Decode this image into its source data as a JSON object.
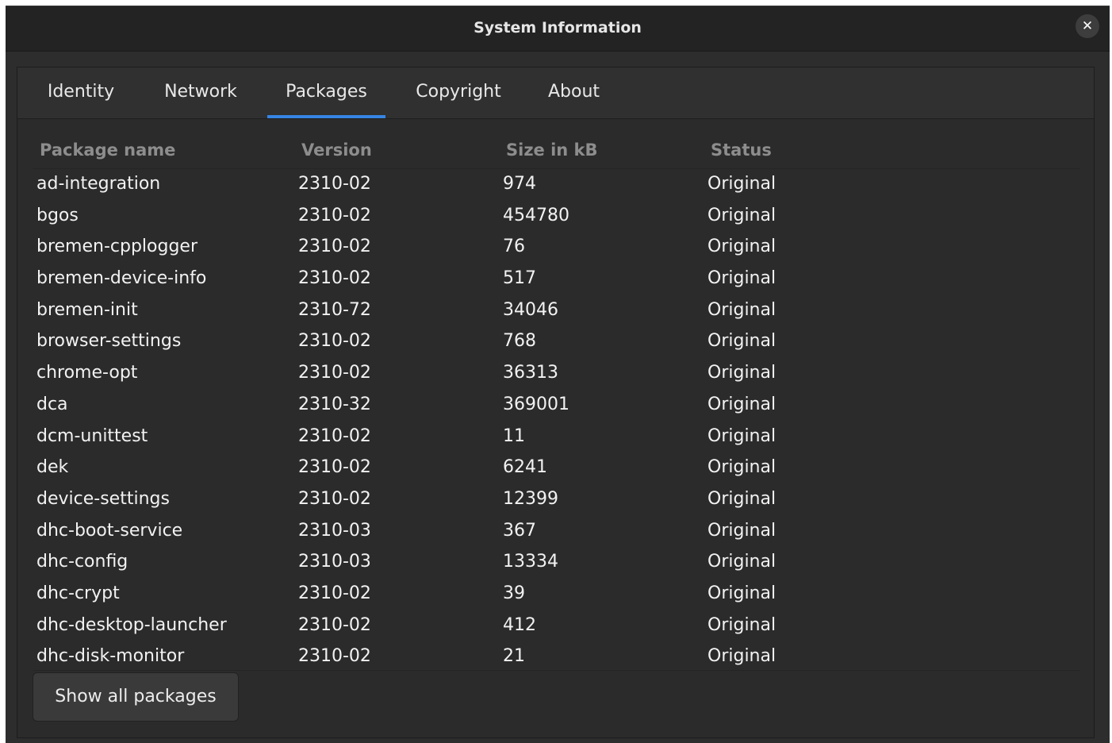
{
  "window": {
    "title": "System Information",
    "close_icon": "close-icon"
  },
  "tabs": [
    {
      "label": "Identity",
      "active": false
    },
    {
      "label": "Network",
      "active": false
    },
    {
      "label": "Packages",
      "active": true
    },
    {
      "label": "Copyright",
      "active": false
    },
    {
      "label": "About",
      "active": false
    }
  ],
  "accent_color": "#3584e4",
  "table": {
    "columns": [
      "Package name",
      "Version",
      "Size in kB",
      "Status"
    ],
    "rows": [
      [
        "ad-integration",
        "2310-02",
        "974",
        "Original"
      ],
      [
        "bgos",
        "2310-02",
        "454780",
        "Original"
      ],
      [
        "bremen-cpplogger",
        "2310-02",
        "76",
        "Original"
      ],
      [
        "bremen-device-info",
        "2310-02",
        "517",
        "Original"
      ],
      [
        "bremen-init",
        "2310-72",
        "34046",
        "Original"
      ],
      [
        "browser-settings",
        "2310-02",
        "768",
        "Original"
      ],
      [
        "chrome-opt",
        "2310-02",
        "36313",
        "Original"
      ],
      [
        "dca",
        "2310-32",
        "369001",
        "Original"
      ],
      [
        "dcm-unittest",
        "2310-02",
        "11",
        "Original"
      ],
      [
        "dek",
        "2310-02",
        "6241",
        "Original"
      ],
      [
        "device-settings",
        "2310-02",
        "12399",
        "Original"
      ],
      [
        "dhc-boot-service",
        "2310-03",
        "367",
        "Original"
      ],
      [
        "dhc-config",
        "2310-03",
        "13334",
        "Original"
      ],
      [
        "dhc-crypt",
        "2310-02",
        "39",
        "Original"
      ],
      [
        "dhc-desktop-launcher",
        "2310-02",
        "412",
        "Original"
      ],
      [
        "dhc-disk-monitor",
        "2310-02",
        "21",
        "Original"
      ]
    ]
  },
  "show_all_label": "Show all packages"
}
